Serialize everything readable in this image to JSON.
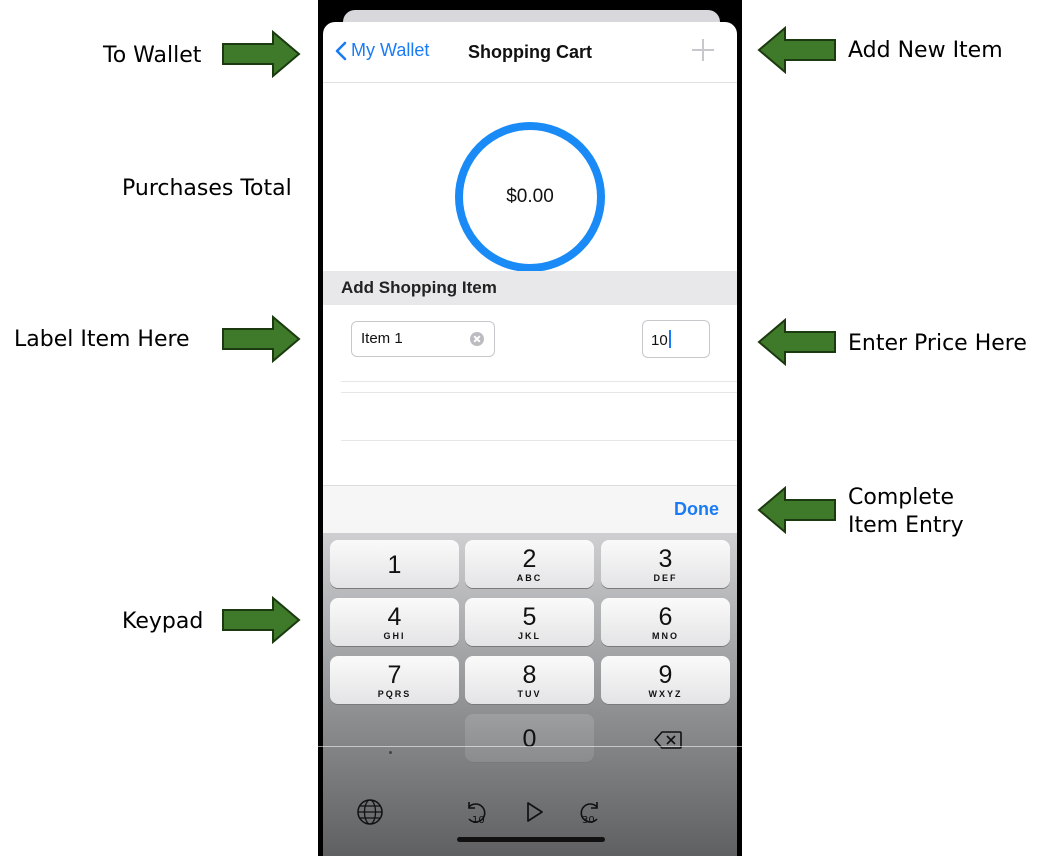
{
  "annotations": {
    "to_wallet": "To Wallet",
    "add_new_item": "Add New Item",
    "purchases_total": "Purchases Total",
    "label_item_here": "Label Item Here",
    "enter_price_here": "Enter Price Here",
    "complete_line1": "Complete",
    "complete_line2": "Item Entry",
    "keypad": "Keypad"
  },
  "nav": {
    "back_label": "My Wallet",
    "title": "Shopping Cart",
    "add_icon": "plus-icon"
  },
  "total": {
    "amount": "$0.00"
  },
  "section": {
    "title": "Add Shopping Item"
  },
  "form": {
    "item_name": "Item 1",
    "price": "10"
  },
  "toolbar": {
    "done_label": "Done"
  },
  "keypad": {
    "keys": [
      {
        "num": "1",
        "letters": ""
      },
      {
        "num": "2",
        "letters": "ABC"
      },
      {
        "num": "3",
        "letters": "DEF"
      },
      {
        "num": "4",
        "letters": "GHI"
      },
      {
        "num": "5",
        "letters": "JKL"
      },
      {
        "num": "6",
        "letters": "MNO"
      },
      {
        "num": "7",
        "letters": "PQRS"
      },
      {
        "num": "8",
        "letters": "TUV"
      },
      {
        "num": "9",
        "letters": "WXYZ"
      },
      {
        "num": "0",
        "letters": ""
      }
    ]
  },
  "colors": {
    "accent": "#1a7cf5",
    "ring": "#1a8bf6",
    "arrow_fill": "#3e7a2a",
    "arrow_stroke": "#1b3a10"
  }
}
